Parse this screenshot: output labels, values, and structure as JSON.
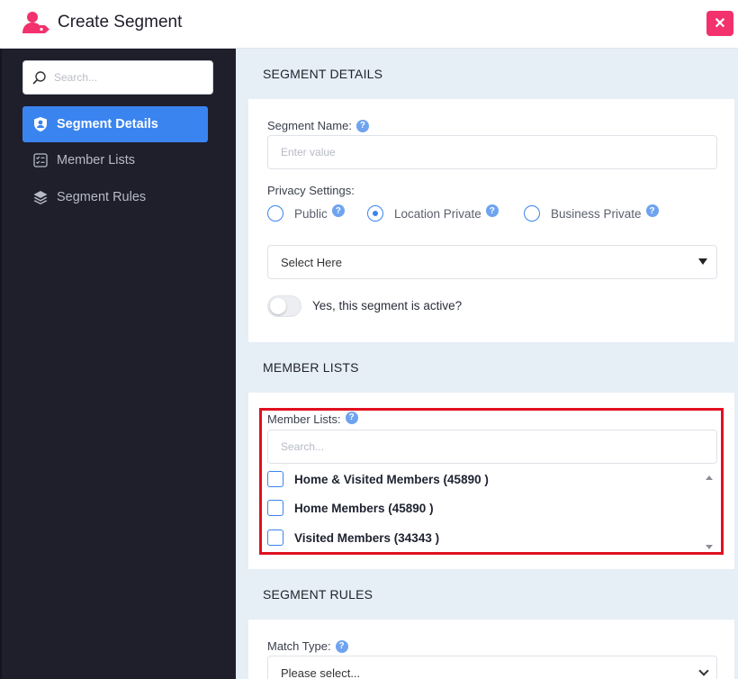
{
  "header": {
    "title": "Create Segment",
    "close_label": "✕"
  },
  "sidebar": {
    "search": {
      "placeholder": "Search..."
    },
    "items": [
      {
        "label": "Segment Details",
        "icon": "shield-person-icon",
        "active": true
      },
      {
        "label": "Member Lists",
        "icon": "checklist-icon",
        "active": false
      },
      {
        "label": "Segment Rules",
        "icon": "layers-icon",
        "active": false
      }
    ]
  },
  "segment_details": {
    "heading": "SEGMENT DETAILS",
    "name_label": "Segment Name:",
    "name_placeholder": "Enter value",
    "privacy_label": "Privacy Settings:",
    "privacy_options": [
      {
        "label": "Public",
        "checked": false
      },
      {
        "label": "Location Private",
        "checked": true
      },
      {
        "label": "Business Private",
        "checked": false
      }
    ],
    "select_value": "Select Here",
    "active_toggle_label": "Yes, this segment is active?",
    "active": false
  },
  "member_lists": {
    "heading": "MEMBER LISTS",
    "label": "Member Lists:",
    "search_placeholder": "Search...",
    "items": [
      {
        "label": "Home & Visited Members (45890 )",
        "checked": false
      },
      {
        "label": "Home Members (45890 )",
        "checked": false
      },
      {
        "label": "Visited Members (34343 )",
        "checked": false
      }
    ]
  },
  "segment_rules": {
    "heading": "SEGMENT RULES",
    "match_type_label": "Match Type:",
    "match_type_value": "Please select..."
  },
  "help_glyph": "?",
  "colors": {
    "accent": "#3a84ef",
    "sidebar_bg": "#1f1f2c",
    "close_bg": "#f2316d",
    "highlight": "#e01020",
    "section_bg": "#e6eef6"
  }
}
